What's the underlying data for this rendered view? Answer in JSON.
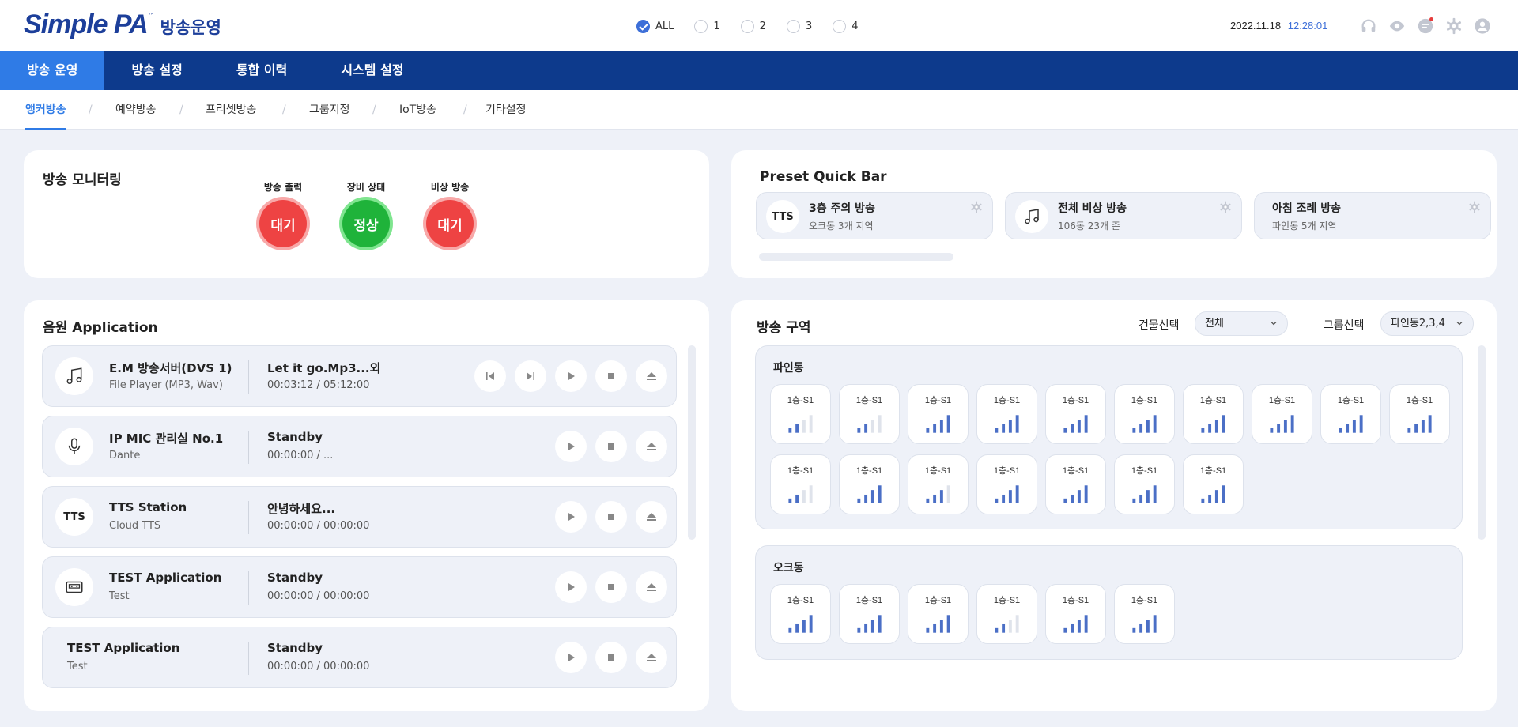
{
  "header": {
    "logo_text": "Simple PA",
    "logo_tm": "™",
    "app_title": "방송운영",
    "filters": [
      {
        "label": "ALL",
        "checked": true
      },
      {
        "label": "1",
        "checked": false
      },
      {
        "label": "2",
        "checked": false
      },
      {
        "label": "3",
        "checked": false
      },
      {
        "label": "4",
        "checked": false
      }
    ],
    "date": "2022.11.18",
    "time": "12:28:01",
    "icons": [
      "headset-icon",
      "eye-icon",
      "message-icon",
      "settings-icon",
      "user-icon"
    ]
  },
  "main_nav": [
    "방송 운영",
    "방송 설정",
    "통합 이력",
    "시스템 설정"
  ],
  "sub_nav": [
    "앵커방송",
    "예약방송",
    "프리셋방송",
    "그룹지정",
    "IoT방송",
    "기타설정"
  ],
  "monitoring": {
    "title": "방송 모니터링",
    "statuses": [
      {
        "label": "방송 출력",
        "value": "대기",
        "color": "#ee4343"
      },
      {
        "label": "장비 상태",
        "value": "정상",
        "color": "#1fb33a"
      },
      {
        "label": "비상 방송",
        "value": "대기",
        "color": "#ee4343"
      }
    ]
  },
  "preset": {
    "title": "Preset Quick Bar",
    "items": [
      {
        "icon": "TTS",
        "name": "3층 주의 방송",
        "desc": "오크동 3개 지역"
      },
      {
        "icon": "music-icon",
        "name": "전체 비상 방송",
        "desc": "106동 23개 존"
      },
      {
        "icon": "",
        "name": "아침 조례 방송",
        "desc": "파인동 5개 지역"
      }
    ]
  },
  "audio": {
    "title": "음원 Application",
    "rows": [
      {
        "icon": "music-icon",
        "name": "E.M 방송서버(DVS 1)",
        "sub": "File Player (MP3, Wav)",
        "track": "Let it go.Mp3...외",
        "time": "00:03:12 / 05:12:00"
      },
      {
        "icon": "mic-icon",
        "name": "IP MIC 관리실 No.1",
        "sub": "Dante",
        "track": "Standby",
        "time": "00:00:00 / ..."
      },
      {
        "icon": "TTS",
        "name": "TTS Station",
        "sub": "Cloud TTS",
        "track": "안녕하세요...",
        "time": "00:00:00 / 00:00:00"
      },
      {
        "icon": "cassette-icon",
        "name": "TEST Application",
        "sub": "Test",
        "track": "Standby",
        "time": "00:00:00 / 00:00:00"
      },
      {
        "icon": "",
        "name": "TEST Application",
        "sub": "Test",
        "track": "Standby",
        "time": "00:00:00 / 00:00:00"
      }
    ]
  },
  "zones": {
    "title": "방송 구역",
    "building_label": "건물선택",
    "building_value": "전체",
    "group_label": "그룹선택",
    "group_value": "파인동2,3,4",
    "groups": [
      {
        "name": "파인동",
        "cells": [
          {
            "label": "1층-S1",
            "level": 2
          },
          {
            "label": "1층-S1",
            "level": 2
          },
          {
            "label": "1층-S1",
            "level": 4
          },
          {
            "label": "1층-S1",
            "level": 4
          },
          {
            "label": "1층-S1",
            "level": 4
          },
          {
            "label": "1층-S1",
            "level": 4
          },
          {
            "label": "1층-S1",
            "level": 4
          },
          {
            "label": "1층-S1",
            "level": 4
          },
          {
            "label": "1층-S1",
            "level": 4
          },
          {
            "label": "1층-S1",
            "level": 4
          },
          {
            "label": "1층-S1",
            "level": 2
          },
          {
            "label": "1층-S1",
            "level": 4
          },
          {
            "label": "1층-S1",
            "level": 3
          },
          {
            "label": "1층-S1",
            "level": 4
          },
          {
            "label": "1층-S1",
            "level": 4
          },
          {
            "label": "1층-S1",
            "level": 4
          },
          {
            "label": "1층-S1",
            "level": 4
          }
        ]
      },
      {
        "name": "오크동",
        "cells": [
          {
            "label": "1층-S1",
            "level": 4
          },
          {
            "label": "1층-S1",
            "level": 4
          },
          {
            "label": "1층-S1",
            "level": 4
          },
          {
            "label": "1층-S1",
            "level": 2
          },
          {
            "label": "1층-S1",
            "level": 4
          },
          {
            "label": "1층-S1",
            "level": 4
          }
        ]
      }
    ]
  },
  "colors": {
    "brand": "#0d3a8c",
    "accent": "#2f7be6",
    "bar_on": "#4b6fc6",
    "bar_off": "#dfe3eb"
  }
}
